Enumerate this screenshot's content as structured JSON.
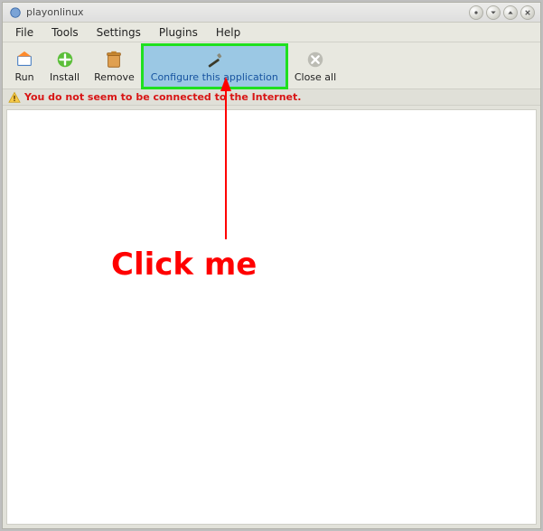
{
  "titlebar": {
    "title": "playonlinux"
  },
  "menu": {
    "items": [
      {
        "label": "File"
      },
      {
        "label": "Tools"
      },
      {
        "label": "Settings"
      },
      {
        "label": "Plugins"
      },
      {
        "label": "Help"
      }
    ]
  },
  "toolbar": {
    "run": {
      "label": "Run"
    },
    "install": {
      "label": "Install"
    },
    "remove": {
      "label": "Remove"
    },
    "configure": {
      "label": "Configure this application"
    },
    "closeall": {
      "label": "Close all"
    }
  },
  "status": {
    "message": "You do not seem to be connected to the Internet."
  },
  "annotation": {
    "text": "Click me"
  }
}
